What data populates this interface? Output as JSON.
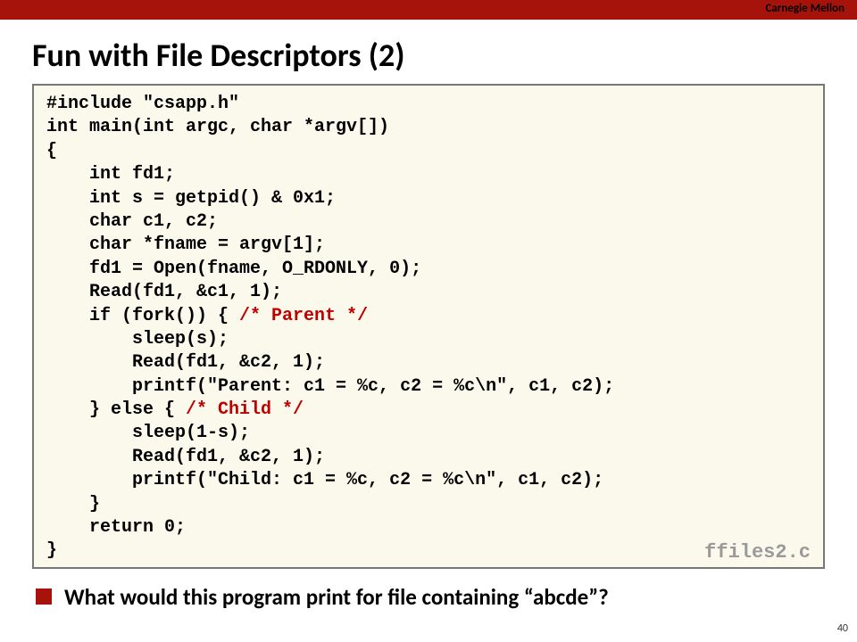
{
  "header": {
    "brand": "Carnegie Mellon"
  },
  "slide": {
    "title": "Fun with File Descriptors (2)",
    "page_number": "40"
  },
  "code": {
    "filename": "ffiles2.c",
    "lines": {
      "l0": "#include \"csapp.h\"",
      "l1": "int main(int argc, char *argv[])",
      "l2": "{",
      "l3": "    int fd1;",
      "l4": "    int s = getpid() & 0x1;",
      "l5": "    char c1, c2;",
      "l6": "    char *fname = argv[1];",
      "l7": "    fd1 = Open(fname, O_RDONLY, 0);",
      "l8": "    Read(fd1, &c1, 1);",
      "l9a": "    if (fork()) { ",
      "l9b": "/* Parent */",
      "l10": "        sleep(s);",
      "l11": "        Read(fd1, &c2, 1);",
      "l12": "        printf(\"Parent: c1 = %c, c2 = %c\\n\", c1, c2);",
      "l13a": "    } else { ",
      "l13b": "/* Child */",
      "l14": "        sleep(1-s);",
      "l15": "        Read(fd1, &c2, 1);",
      "l16": "        printf(\"Child: c1 = %c, c2 = %c\\n\", c1, c2);",
      "l17": "    }",
      "l18": "    return 0;",
      "l19": "}"
    }
  },
  "question": {
    "text": "What would this program print for file containing “abcde”?"
  }
}
